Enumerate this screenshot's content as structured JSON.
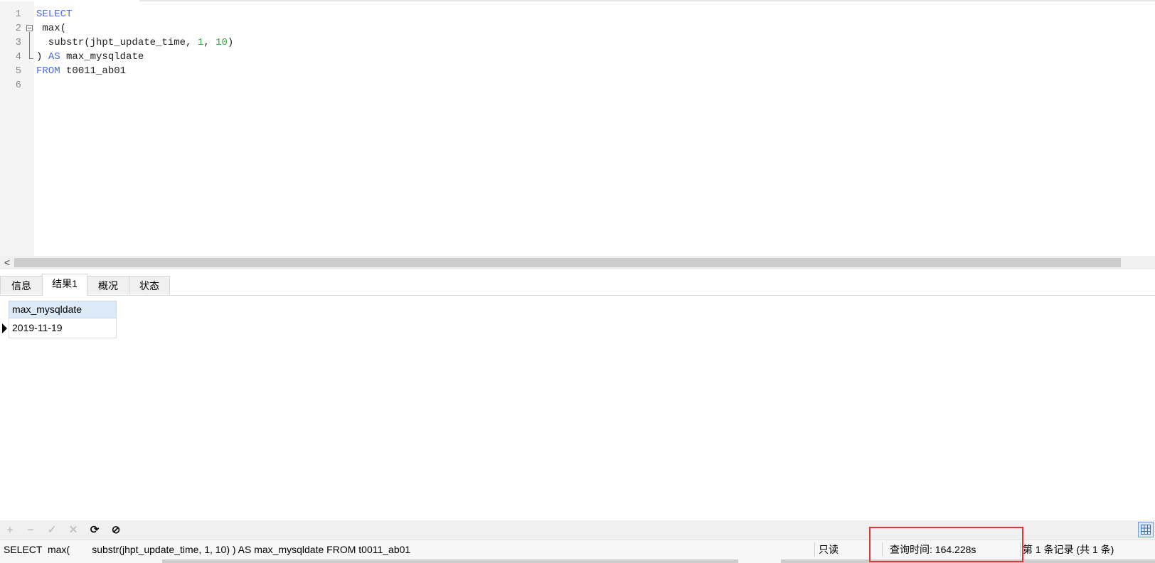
{
  "editor": {
    "lines": [
      {
        "num": "1",
        "parts": [
          {
            "t": "SELECT",
            "c": "kw"
          }
        ]
      },
      {
        "num": "2",
        "parts": [
          {
            "t": " max(",
            "c": "txt"
          }
        ]
      },
      {
        "num": "3",
        "parts": [
          {
            "t": "  substr(jhpt_update_time, ",
            "c": "txt"
          },
          {
            "t": "1",
            "c": "num"
          },
          {
            "t": ", ",
            "c": "txt"
          },
          {
            "t": "10",
            "c": "num"
          },
          {
            "t": ")",
            "c": "txt"
          }
        ]
      },
      {
        "num": "4",
        "parts": [
          {
            "t": ") ",
            "c": "txt"
          },
          {
            "t": "AS",
            "c": "kw"
          },
          {
            "t": " max_mysqldate",
            "c": "txt"
          }
        ]
      },
      {
        "num": "5",
        "parts": [
          {
            "t": "FROM",
            "c": "kw"
          },
          {
            "t": " t0011_ab01",
            "c": "txt"
          }
        ]
      },
      {
        "num": "6",
        "parts": []
      }
    ]
  },
  "scroll": {
    "left_arrow": "<"
  },
  "tabs": [
    {
      "label": "信息",
      "active": false
    },
    {
      "label": "结果1",
      "active": true
    },
    {
      "label": "概况",
      "active": false
    },
    {
      "label": "状态",
      "active": false
    }
  ],
  "result": {
    "columns": [
      "max_mysqldate"
    ],
    "rows": [
      [
        "2019-11-19"
      ]
    ]
  },
  "toolbar": {
    "add": "+",
    "remove": "−",
    "apply": "✓",
    "discard": "✕",
    "refresh": "⟳",
    "stop": "⊘"
  },
  "status": {
    "sql": "SELECT  max(        substr(jhpt_update_time, 1, 10) ) AS max_mysqldate FROM t0011_ab01",
    "readonly": "只读",
    "query_time": "查询时间: 164.228s",
    "records": "第 1 条记录 (共 1 条)"
  },
  "colors": {
    "keyword": "#4a6ee0",
    "number": "#3aaa3a",
    "highlight_box": "#e0363d"
  }
}
